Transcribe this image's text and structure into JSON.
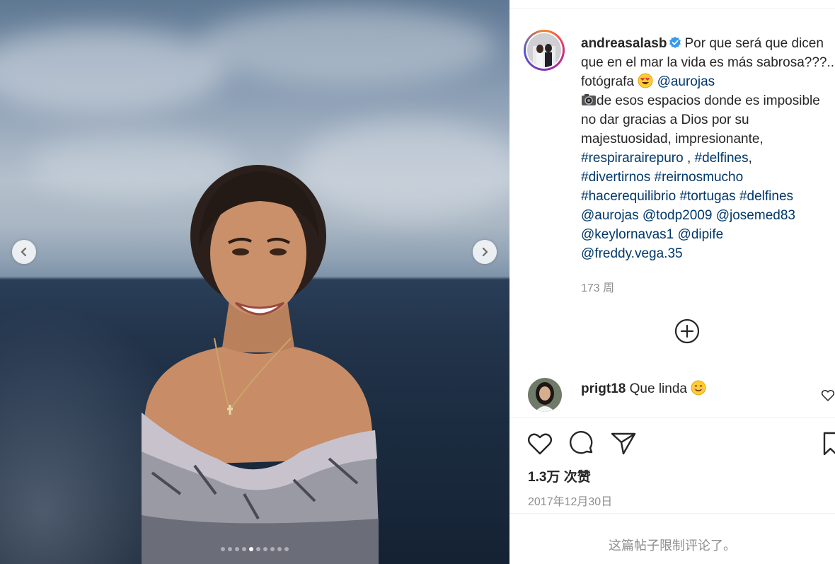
{
  "post": {
    "username": "andreasalasb",
    "verified": true,
    "caption_text_1": "Por que será que dicen que en el mar la vida es más sabrosa???.. fotógrafa ",
    "caption_mention_1": "@aurojas",
    "caption_text_2": "de esos espacios donde es imposible no dar gracias a Dios por su majestuosidad, impresionante, ",
    "hashtags": [
      {
        "text": "#respiraraire​puro"
      },
      {
        "text": "#delfines"
      },
      {
        "text": "#divertirnos"
      },
      {
        "text": "#reirnosmucho"
      },
      {
        "text": "#hacerequilibrio"
      },
      {
        "text": "#tortugas"
      },
      {
        "text": "#delfines"
      }
    ],
    "mentions": [
      "@aurojas",
      "@todp2009",
      "@josemed83",
      "@keylornavas1",
      "@dipife",
      "@freddy.vega.35"
    ],
    "time_ago": "173 周",
    "likes": "1.3万 次赞",
    "date": "2017年12月30日",
    "comments_limited": "这篇帖子限制评论了。"
  },
  "comment": {
    "username": "prigt18",
    "text": "Que linda"
  },
  "carousel": {
    "total": 10,
    "active_index": 4
  },
  "icons": {
    "prev": "chevron-left-icon",
    "next": "chevron-right-icon",
    "verified": "verified-badge-icon",
    "more": "add-circle-icon",
    "like": "heart-icon",
    "comment": "comment-bubble-icon",
    "share": "paper-plane-icon",
    "save": "bookmark-icon"
  },
  "colors": {
    "link": "#00376b",
    "muted": "#8e8e8e",
    "verified": "#3897f0"
  }
}
